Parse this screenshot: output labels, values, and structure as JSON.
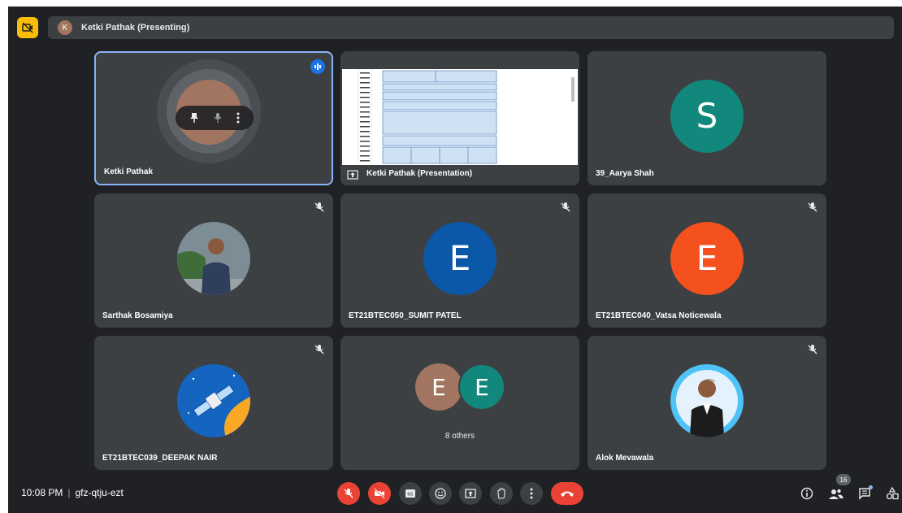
{
  "header": {
    "presenter_initial": "K",
    "presenting_label": "Ketki Pathak (Presenting)"
  },
  "tiles": [
    {
      "name": "Ketki Pathak"
    },
    {
      "name": "Ketki Pathak (Presentation)"
    },
    {
      "name": "39_Aarya Shah",
      "initial": "S",
      "color": "#12877b"
    },
    {
      "name": "Sarthak Bosamiya"
    },
    {
      "name": "ET21BTEC050_SUMIT PATEL",
      "initial": "E",
      "color": "#0b57a8"
    },
    {
      "name": "ET21BTEC040_Vatsa Noticewala",
      "initial": "E",
      "color": "#f4511e"
    },
    {
      "name": "ET21BTEC039_DEEPAK NAIR"
    },
    {
      "name": "8 others",
      "initials": [
        "E",
        "E"
      ],
      "colors": [
        "#a1755f",
        "#12877b"
      ]
    },
    {
      "name": "Alok Mevawala"
    }
  ],
  "footer": {
    "time": "10:08 PM",
    "separator": "|",
    "meeting_code": "gfz-qtju-ezt",
    "participant_count": "16"
  },
  "colors": {
    "background": "#202124",
    "tile": "#3c4043",
    "danger": "#ea4335",
    "accent": "#8ab4f8",
    "warning": "#fbbc04"
  }
}
